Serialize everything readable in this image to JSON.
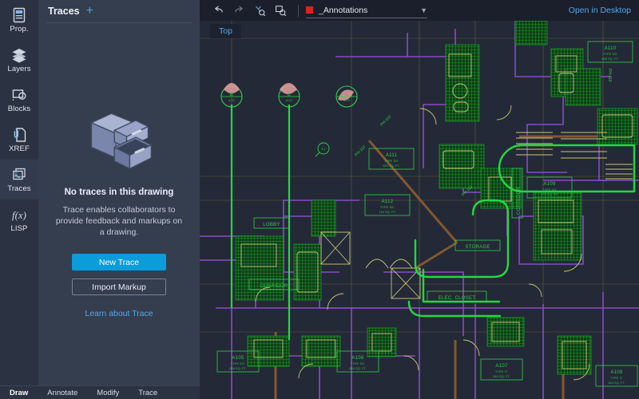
{
  "app": {
    "background": "#232936",
    "accent": "#0a9cdb",
    "link_color": "#56a7e8"
  },
  "rail": {
    "items": [
      {
        "id": "prop",
        "label": "Prop.",
        "icon": "properties-icon",
        "active": false
      },
      {
        "id": "layers",
        "label": "Layers",
        "icon": "layers-icon",
        "active": false
      },
      {
        "id": "blocks",
        "label": "Blocks",
        "icon": "blocks-icon",
        "active": false
      },
      {
        "id": "xref",
        "label": "XREF",
        "icon": "xref-icon",
        "active": false
      },
      {
        "id": "traces",
        "label": "Traces",
        "icon": "traces-icon",
        "active": true
      },
      {
        "id": "lisp",
        "label": "LISP",
        "icon": "lisp-icon",
        "active": false
      }
    ]
  },
  "panel": {
    "title": "Traces",
    "add_label": "+",
    "empty_title": "No traces in this drawing",
    "empty_description": "Trace enables collaborators to provide feedback and markups on a drawing.",
    "new_trace_label": "New Trace",
    "import_markup_label": "Import Markup",
    "learn_link_label": "Learn about Trace",
    "illustration": "file-cabinet-illustration"
  },
  "bottom_tabs": {
    "items": [
      {
        "label": "Draw",
        "active": true
      },
      {
        "label": "Annotate",
        "active": false
      },
      {
        "label": "Modify",
        "active": false
      },
      {
        "label": "Trace",
        "active": false
      }
    ]
  },
  "toolbar": {
    "undo_icon": "undo-arrow-icon",
    "redo_icon": "redo-arrow-icon",
    "zoom_selection_icon": "zoom-selection-icon",
    "zoom_window_icon": "zoom-window-icon",
    "layer": {
      "color": "#e02020",
      "name": "_Annotations",
      "chevron": "chevron-down-icon"
    },
    "open_in_desktop_label": "Open in Desktop"
  },
  "viewport": {
    "label": "Top"
  },
  "drawing": {
    "rooms": [
      {
        "id": "A105",
        "type": "TYPE 'D1'",
        "area": "856 SQ. FT."
      },
      {
        "id": "A106",
        "type": "TYPE 'D1'",
        "area": "855 SQ. FT."
      },
      {
        "id": "A107",
        "type": "TYPE 'C'",
        "area": "364 SQ. FT."
      },
      {
        "id": "A108",
        "type": "TYPE 'C'",
        "area": "364 SQ. FT."
      },
      {
        "id": "A109",
        "type": "TYPE 'A3'",
        "area": "675 SQ. FT."
      },
      {
        "id": "A110",
        "type": "TYPE 'B3'",
        "area": "898 SQ. FT."
      },
      {
        "id": "A111",
        "type": "TYPE 'B2'",
        "area": "954 SQ. FT."
      },
      {
        "id": "A112",
        "type": "TYPE 'B1'",
        "area": "740 SQ. FT."
      }
    ],
    "spaces": [
      {
        "label": "LOBBY"
      },
      {
        "label": "CORRIDOR"
      },
      {
        "label": "STORAGE"
      },
      {
        "label": "ELEC. CLOSET"
      },
      {
        "label": "CORRIDOR"
      }
    ],
    "section_markers": [
      {
        "letter": "B",
        "sheet": "4.02"
      },
      {
        "letter": "C",
        "sheet": "4.02"
      },
      {
        "letter": "D",
        "sheet": "4.03"
      }
    ],
    "dimension_notes": [
      "PH-110",
      "PH-110",
      "PH-110"
    ],
    "colors": {
      "walls": "#8a4bc4",
      "hatch": "#1c9c28",
      "fixtures": "#c9c878",
      "annotation_green": "#2dd04a",
      "highlight_green": "#23d940",
      "beam_brown": "#8a5a30"
    }
  }
}
